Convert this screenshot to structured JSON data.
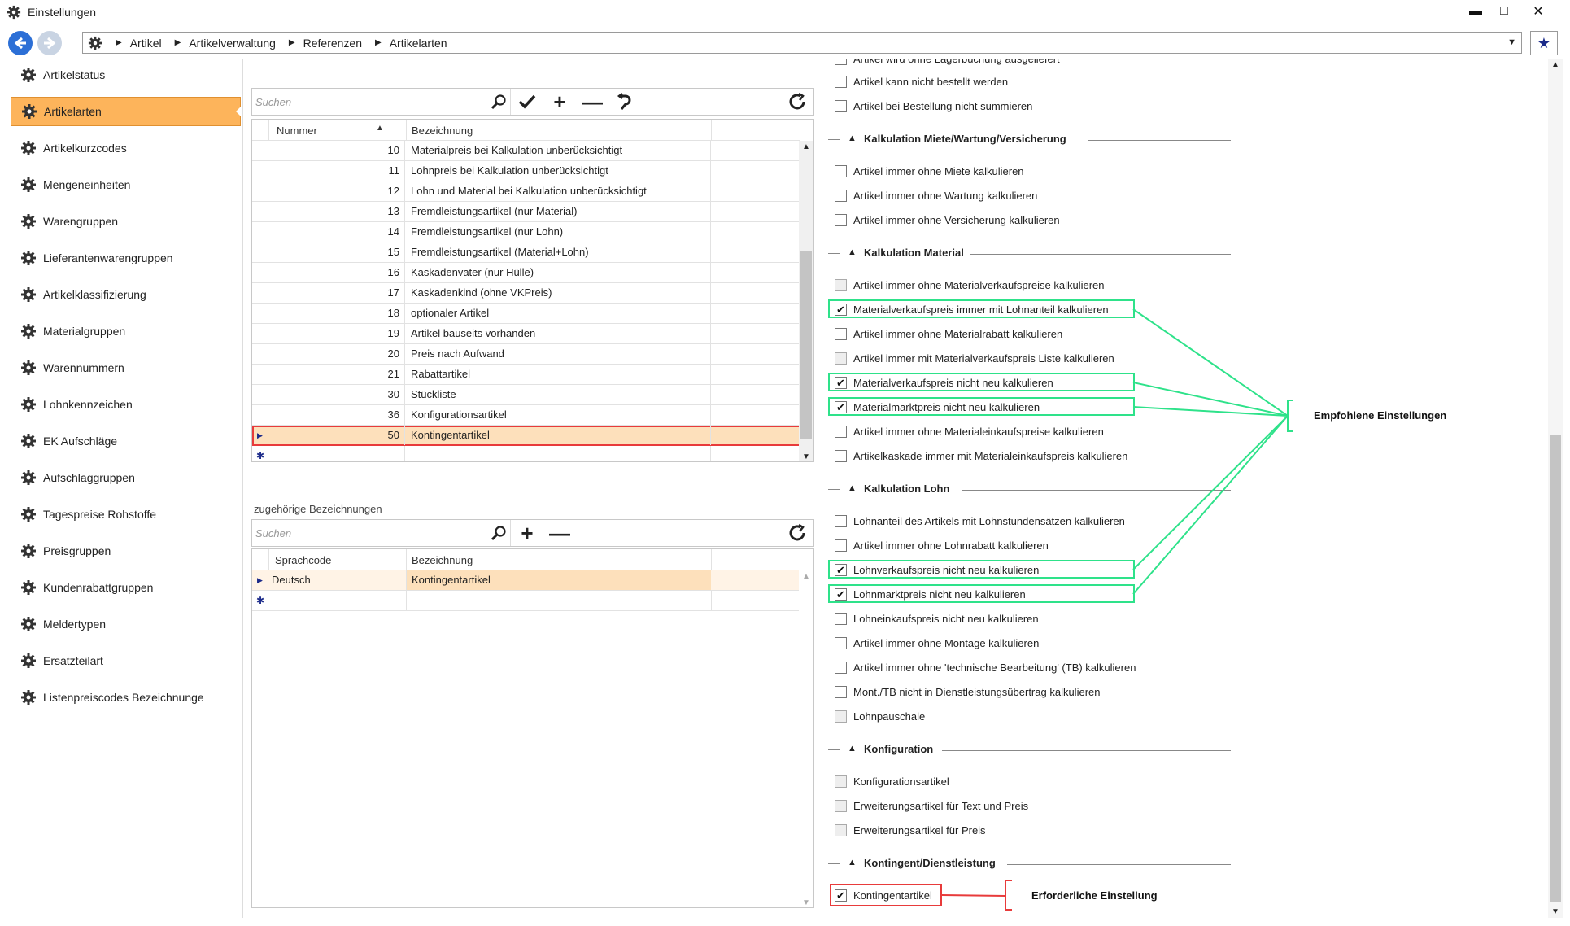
{
  "window": {
    "title": "Einstellungen",
    "minimize": "▬",
    "maximize": "□",
    "close": "✕"
  },
  "breadcrumb": [
    "Artikel",
    "Artikelverwaltung",
    "Referenzen",
    "Artikelarten"
  ],
  "sidebar": {
    "items": [
      "Artikelstatus",
      "Artikelarten",
      "Artikelkurzcodes",
      "Mengeneinheiten",
      "Warengruppen",
      "Lieferantenwarengruppen",
      "Artikelklassifizierung",
      "Materialgruppen",
      "Warennummern",
      "Lohnkennzeichen",
      "EK Aufschläge",
      "Aufschlaggruppen",
      "Tagespreise Rohstoffe",
      "Preisgruppen",
      "Kundenrabattgruppen",
      "Meldertypen",
      "Ersatzteilart",
      "Listenpreiscodes Bezeichnunge"
    ],
    "active": "Artikelarten"
  },
  "grid1": {
    "search_placeholder": "Suchen",
    "col_nummer": "Nummer",
    "col_bezeichnung": "Bezeichnung",
    "rows": [
      {
        "n": "10",
        "b": "Materialpreis bei Kalkulation unberücksichtigt"
      },
      {
        "n": "11",
        "b": "Lohnpreis bei Kalkulation unberücksichtigt"
      },
      {
        "n": "12",
        "b": "Lohn und Material bei Kalkulation unberücksichtigt"
      },
      {
        "n": "13",
        "b": "Fremdleistungsartikel (nur Material)"
      },
      {
        "n": "14",
        "b": "Fremdleistungsartikel (nur Lohn)"
      },
      {
        "n": "15",
        "b": "Fremdleistungsartikel (Material+Lohn)"
      },
      {
        "n": "16",
        "b": "Kaskadenvater (nur Hülle)"
      },
      {
        "n": "17",
        "b": "Kaskadenkind (ohne VKPreis)"
      },
      {
        "n": "18",
        "b": "optionaler Artikel"
      },
      {
        "n": "19",
        "b": "Artikel bauseits vorhanden"
      },
      {
        "n": "20",
        "b": "Preis nach Aufwand"
      },
      {
        "n": "21",
        "b": "Rabattartikel"
      },
      {
        "n": "30",
        "b": "Stückliste"
      },
      {
        "n": "36",
        "b": "Konfigurationsartikel"
      },
      {
        "n": "50",
        "b": "Kontingentartikel"
      }
    ],
    "selected": "50"
  },
  "grid2": {
    "title": "zugehörige Bezeichnungen",
    "search_placeholder": "Suchen",
    "col_sprach": "Sprachcode",
    "col_bez": "Bezeichnung",
    "row_sprache": "Deutsch",
    "row_bez": "Kontingentartikel"
  },
  "settings": {
    "top_cut": "Artikel wird ohne Lagerbuchung ausgeliefert",
    "top": [
      "Artikel kann nicht bestellt werden",
      "Artikel bei Bestellung nicht summieren"
    ],
    "sec_miete": "Kalkulation Miete/Wartung/Versicherung",
    "miete": [
      "Artikel immer ohne Miete kalkulieren",
      "Artikel immer ohne Wartung kalkulieren",
      "Artikel immer ohne Versicherung kalkulieren"
    ],
    "sec_material": "Kalkulation Material",
    "material": [
      "Artikel immer ohne Materialverkaufspreise kalkulieren",
      "Materialverkaufspreis immer mit Lohnanteil kalkulieren",
      "Artikel immer ohne Materialrabatt kalkulieren",
      "Artikel immer mit Materialverkaufspreis Liste kalkulieren",
      "Materialverkaufspreis nicht neu kalkulieren",
      "Materialmarktpreis nicht neu kalkulieren",
      "Artikel immer ohne Materialeinkaufspreise kalkulieren",
      "Artikelkaskade immer mit Materialeinkaufspreis kalkulieren"
    ],
    "sec_lohn": "Kalkulation Lohn",
    "lohn": [
      "Lohnanteil des Artikels mit Lohnstundensätzen kalkulieren",
      "Artikel immer ohne Lohnrabatt kalkulieren",
      "Lohnverkaufspreis nicht neu kalkulieren",
      "Lohnmarktpreis nicht neu kalkulieren",
      "Lohneinkaufspreis nicht neu kalkulieren",
      "Artikel immer ohne Montage kalkulieren",
      "Artikel immer ohne 'technische Bearbeitung' (TB) kalkulieren",
      "Mont./TB nicht in Dienstleistungsübertrag kalkulieren",
      "Lohnpauschale"
    ],
    "sec_konfig": "Konfiguration",
    "konfig": [
      "Konfigurationsartikel",
      "Erweiterungsartikel für Text und Preis",
      "Erweiterungsartikel für Preis"
    ],
    "sec_kontingent": "Kontingent/Dienstleistung",
    "kontingent": [
      "Kontingentartikel"
    ]
  },
  "annotations": {
    "recommended": "Empfohlene Einstellungen",
    "required": "Erforderliche Einstellung"
  },
  "colors": {
    "accent": "#fdb45b",
    "green": "#2ee28a",
    "red": "#e83b3b",
    "selrow": "#fde0bb"
  }
}
